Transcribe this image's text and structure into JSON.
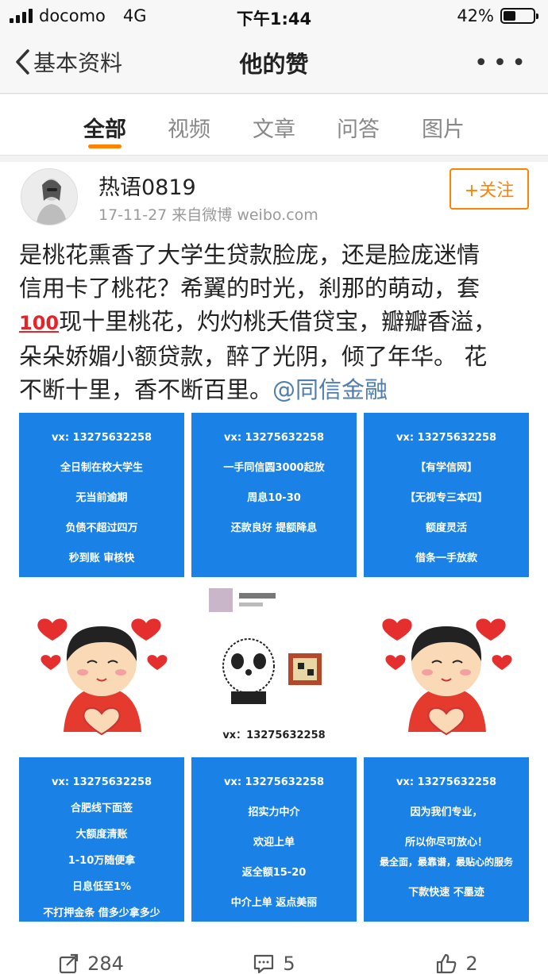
{
  "status_bar": {
    "carrier": "docomo",
    "network": "4G",
    "time": "下午1:44",
    "battery": "42%",
    "battery_level": 0.42
  },
  "nav": {
    "back_label": "基本资料",
    "title": "他的赞",
    "more": "•••"
  },
  "tabs": [
    {
      "label": "全部",
      "active": true
    },
    {
      "label": "视频",
      "active": false
    },
    {
      "label": "文章",
      "active": false
    },
    {
      "label": "问答",
      "active": false
    },
    {
      "label": "图片",
      "active": false
    }
  ],
  "post": {
    "username": "热语0819",
    "meta": "17-11-27  来自微博 weibo.com",
    "follow_label": "+关注",
    "text_line1": "是桃花熏香了大学生贷款脸庞，还是脸庞迷情",
    "text_line2": "信用卡了桃花？希翼的时光，刹那的萌动，套",
    "emoji": "100",
    "text_line3": "现十里桃花，灼灼桃夭借贷宝，瓣瓣香溢，",
    "text_line4": "朵朵娇媚小额贷款，醉了光阴，倾了年华。 花",
    "text_line5": "不断十里，香不断百里。",
    "mention": "@同信金融"
  },
  "images": {
    "img1": [
      "vx: 13275632258",
      "全日制在校大学生",
      "无当前逾期",
      "负债不超过四万",
      "秒到账    审核快"
    ],
    "img2": [
      "vx: 13275632258",
      "一手同信圆3000起放",
      "周息10-30",
      "还款良好   提额降息"
    ],
    "img3": [
      "vx: 13275632258",
      "【有学信网】",
      "【无视专三本四】",
      "额度灵活",
      "借条一手放款"
    ],
    "img5": [
      "vx：13275632258"
    ],
    "img7": [
      "vx: 13275632258",
      "合肥线下面签",
      "大额度清账",
      "1-10万随便拿",
      "日息低至1%",
      "不打押金条   借多少拿多少"
    ],
    "img8": [
      "vx: 13275632258",
      "招实力中介",
      "欢迎上单",
      "返全额15-20",
      "中介上单   返点美丽"
    ],
    "img9": [
      "vx: 13275632258",
      "因为我们专业，",
      "所以你尽可放心！",
      "最全面，最靠谱，最贴心的服务",
      "下款快速   不墨迹"
    ]
  },
  "actions": {
    "repost": "284",
    "comment": "5",
    "like": "2"
  },
  "colors": {
    "accent": "#ff8200",
    "link": "#507daf",
    "tile_blue": "#1a82e6"
  }
}
